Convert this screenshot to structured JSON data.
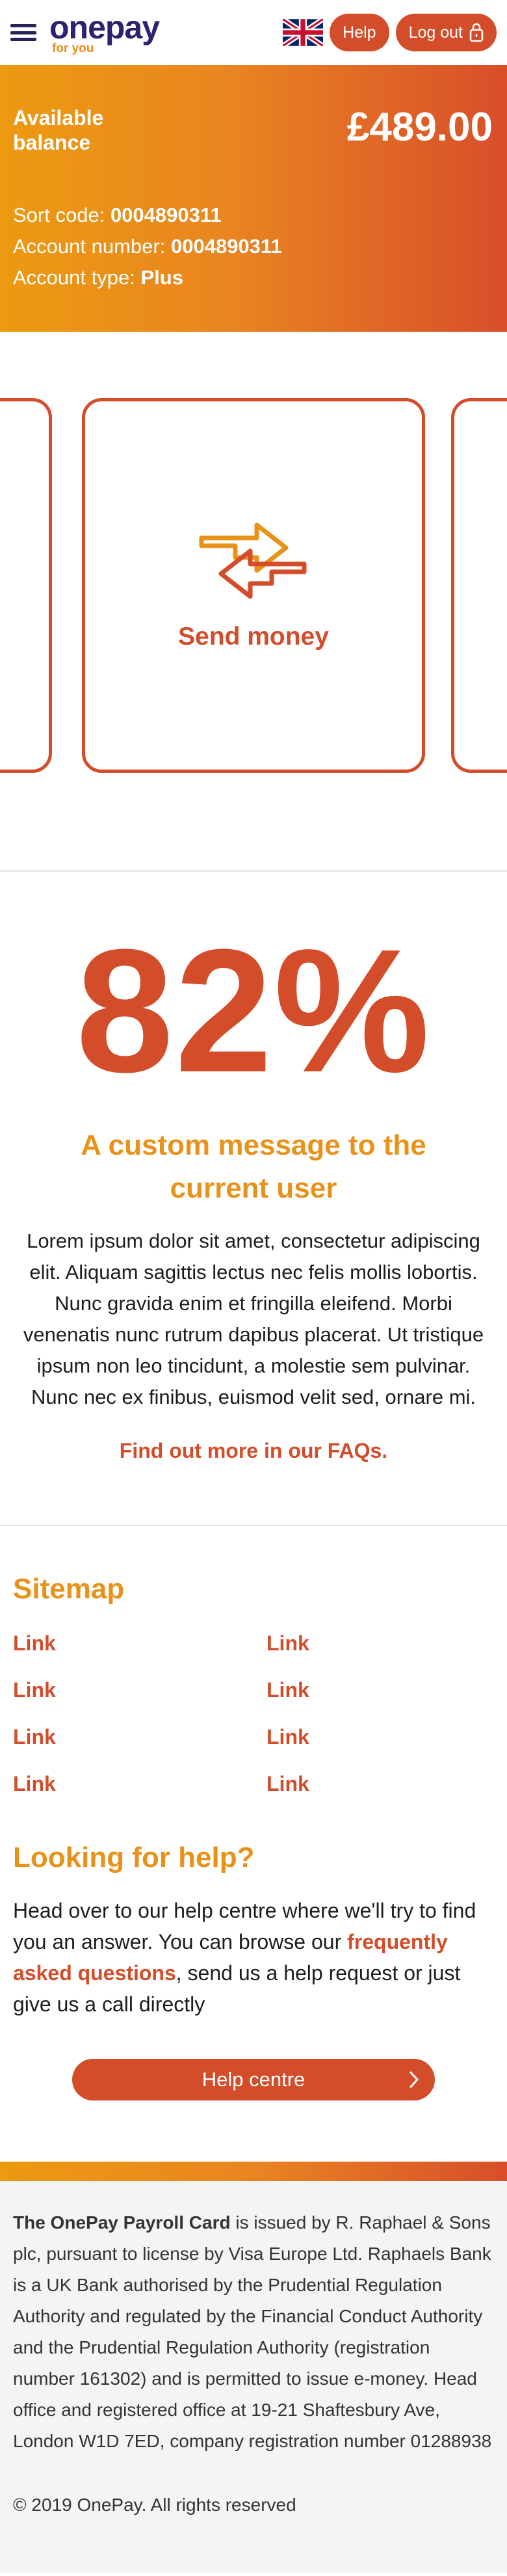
{
  "header": {
    "logo_word": "onepay",
    "logo_tagline": "for you",
    "help_label": "Help",
    "logout_label": "Log out"
  },
  "balance": {
    "label": "Available balance",
    "amount": "£489.00",
    "sort_code_label": "Sort code:",
    "sort_code": "0004890311",
    "account_number_label": "Account number:",
    "account_number": "0004890311",
    "account_type_label": "Account type:",
    "account_type": "Plus"
  },
  "carousel": {
    "active_card_label": "Send money",
    "dot_count": 8,
    "active_dot_index": 3
  },
  "stat": {
    "value": "82%",
    "heading": "A custom message to the current user",
    "body": "Lorem ipsum dolor sit amet, consectetur adipiscing elit. Aliquam sagittis lectus nec felis mollis lobortis. Nunc gravida enim et fringilla eleifend. Morbi venenatis nunc rutrum dapibus placerat. Ut tristique ipsum non leo tincidunt, a molestie sem pulvinar. Nunc nec ex finibus, euismod velit sed, ornare mi.",
    "link": "Find out more in our FAQs."
  },
  "sitemap": {
    "title": "Sitemap",
    "links": [
      "Link",
      "Link",
      "Link",
      "Link",
      "Link",
      "Link",
      "Link",
      "Link"
    ]
  },
  "help": {
    "title": "Looking for help?",
    "text_before": "Head over to our help centre where we'll try to find you an answer. You can browse our ",
    "faq_link": "frequently asked questions",
    "text_after": ", send us a help request or just give us a call directly",
    "button_label": "Help centre"
  },
  "footer": {
    "brand": "The OnePay Payroll Card",
    "legal": " is issued by R. Raphael & Sons plc, pursuant to license by Visa Europe Ltd. Raphaels Bank is a UK Bank authorised by the Prudential Regulation Authority and regulated by the Financial Conduct Authority and the Prudential Regulation Authority (registration number 161302) and is permitted to issue e-money. Head office and registered office at 19-21 Shaftesbury Ave, London W1D 7ED, company registration number 01288938",
    "copyright": "© 2019 OnePay. All rights reserved"
  },
  "colors": {
    "brand_orange": "#e9921a",
    "brand_red": "#d34d2a",
    "brand_navy": "#2c2370"
  },
  "icons": [
    "menu-icon",
    "uk-flag-icon",
    "lock-icon",
    "transfer-arrows-icon",
    "chevron-right-icon"
  ]
}
